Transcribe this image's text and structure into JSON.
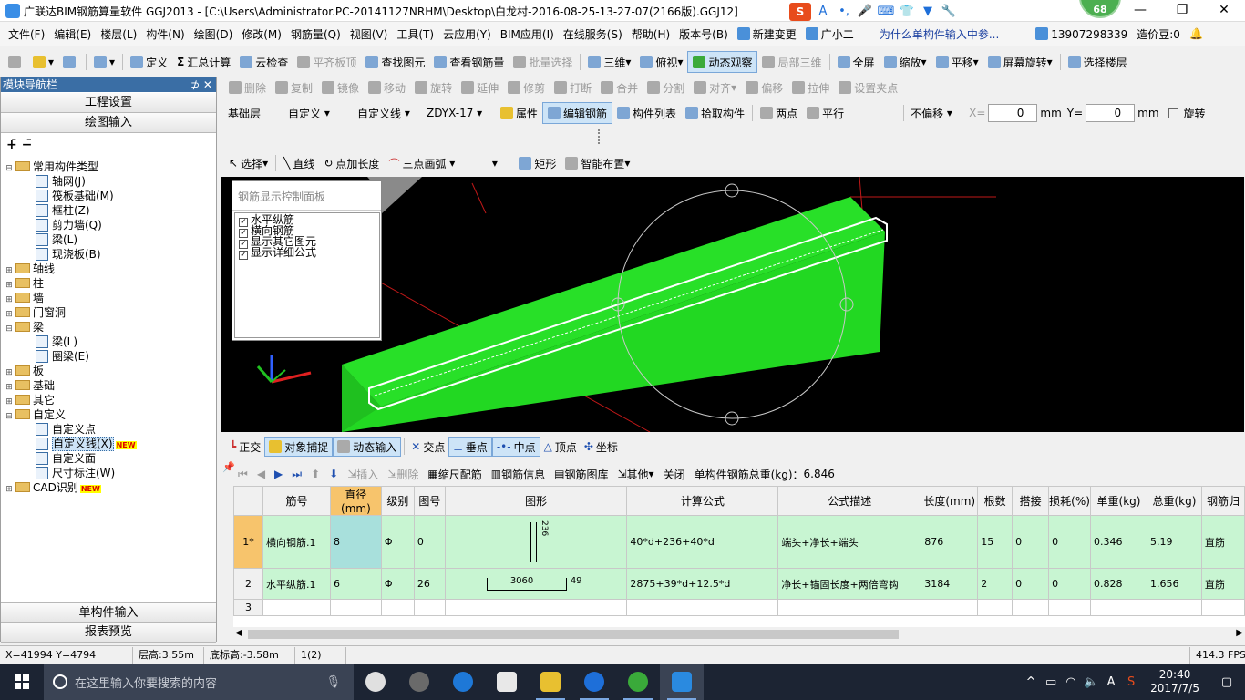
{
  "titlebar": {
    "title": "广联达BIM钢筋算量软件 GGJ2013 - [C:\\Users\\Administrator.PC-20141127NRHM\\Desktop\\白龙村-2016-08-25-13-27-07(2166版).GGJ12]",
    "badge": "68",
    "ime_label": "S",
    "ime_mode": "A",
    "minimize": "—",
    "restore": "❐",
    "close": "✕"
  },
  "menu": {
    "items": [
      "文件(F)",
      "编辑(E)",
      "楼层(L)",
      "构件(N)",
      "绘图(D)",
      "修改(M)",
      "钢筋量(Q)",
      "视图(V)",
      "工具(T)",
      "云应用(Y)",
      "BIM应用(I)",
      "在线服务(S)",
      "帮助(H)",
      "版本号(B)"
    ],
    "new_change": "新建变更",
    "guangxiaoer": "广小二",
    "question": "为什么单构件输入中参...",
    "phone": "13907298339",
    "zaojiadou": "造价豆:0"
  },
  "toolbar1": {
    "items": [
      "定义",
      "汇总计算",
      "云检查",
      "平齐板顶",
      "查找图元",
      "查看钢筋量",
      "批量选择",
      "三维",
      "俯视",
      "动态观察",
      "局部三维",
      "全屏",
      "缩放",
      "平移",
      "屏幕旋转",
      "选择楼层"
    ]
  },
  "toolbar2": {
    "items": [
      "删除",
      "复制",
      "镜像",
      "移动",
      "旋转",
      "延伸",
      "修剪",
      "打断",
      "合并",
      "分割",
      "对齐",
      "偏移",
      "拉伸",
      "设置夹点"
    ]
  },
  "toolbar3": {
    "floor": "基础层",
    "custom": "自定义",
    "custom_line": "自定义线",
    "code": "ZDYX-17",
    "attr": "属性",
    "edit_rebar": "编辑钢筋",
    "component_list": "构件列表",
    "pick": "拾取构件",
    "two_points": "两点",
    "parallel": "平行",
    "offset": "不偏移",
    "x_label": "X=",
    "x_value": "0",
    "y_label": "Y=",
    "y_value": "0",
    "unit": "mm",
    "rotate": "旋转"
  },
  "toolbar4": {
    "select": "选择",
    "line": "直线",
    "point_length": "点加长度",
    "arc": "三点画弧",
    "rect": "矩形",
    "smart": "智能布置"
  },
  "panel": {
    "title": "模块导航栏",
    "pin": "⊅ ✕",
    "eng_settings": "工程设置",
    "draw_input": "绘图输入",
    "single_input": "单构件输入",
    "report_preview": "报表预览",
    "tree": [
      {
        "level": 0,
        "exp": "⊟",
        "folder": true,
        "label": "常用构件类型"
      },
      {
        "level": 1,
        "leaf": true,
        "label": "轴网(J)"
      },
      {
        "level": 1,
        "leaf": true,
        "label": "筏板基础(M)"
      },
      {
        "level": 1,
        "leaf": true,
        "label": "框柱(Z)"
      },
      {
        "level": 1,
        "leaf": true,
        "label": "剪力墙(Q)"
      },
      {
        "level": 1,
        "leaf": true,
        "label": "梁(L)"
      },
      {
        "level": 1,
        "leaf": true,
        "label": "现浇板(B)"
      },
      {
        "level": 0,
        "exp": "⊞",
        "folder": true,
        "label": "轴线"
      },
      {
        "level": 0,
        "exp": "⊞",
        "folder": true,
        "label": "柱"
      },
      {
        "level": 0,
        "exp": "⊞",
        "folder": true,
        "label": "墙"
      },
      {
        "level": 0,
        "exp": "⊞",
        "folder": true,
        "label": "门窗洞"
      },
      {
        "level": 0,
        "exp": "⊟",
        "folder": true,
        "label": "梁"
      },
      {
        "level": 1,
        "leaf": true,
        "label": "梁(L)"
      },
      {
        "level": 1,
        "leaf": true,
        "label": "圈梁(E)"
      },
      {
        "level": 0,
        "exp": "⊞",
        "folder": true,
        "label": "板"
      },
      {
        "level": 0,
        "exp": "⊞",
        "folder": true,
        "label": "基础"
      },
      {
        "level": 0,
        "exp": "⊞",
        "folder": true,
        "label": "其它"
      },
      {
        "level": 0,
        "exp": "⊟",
        "folder": true,
        "label": "自定义"
      },
      {
        "level": 1,
        "leaf": true,
        "label": "自定义点"
      },
      {
        "level": 1,
        "leaf": true,
        "label": "自定义线(X)",
        "selected": true,
        "new": "NEW"
      },
      {
        "level": 1,
        "leaf": true,
        "label": "自定义面"
      },
      {
        "level": 1,
        "leaf": true,
        "label": "尺寸标注(W)"
      },
      {
        "level": 0,
        "exp": "⊞",
        "folder": true,
        "label": "CAD识别",
        "new": "NEW"
      }
    ]
  },
  "rebar_panel": {
    "title": "钢筋显示控制面板",
    "items": [
      "水平纵筋",
      "横向钢筋",
      "显示其它图元",
      "显示详细公式"
    ]
  },
  "snapbar": {
    "items": [
      "正交",
      "对象捕捉",
      "动态输入",
      "交点",
      "垂点",
      "中点",
      "顶点",
      "坐标"
    ]
  },
  "gridtb": {
    "insert": "插入",
    "delete": "删除",
    "scale": "缩尺配筋",
    "info": "钢筋信息",
    "library": "钢筋图库",
    "other": "其他",
    "close": "关闭",
    "total_label": "单构件钢筋总重(kg)：",
    "total_value": "6.846"
  },
  "table": {
    "headers": [
      "",
      "筋号",
      "直径(mm)",
      "级别",
      "图号",
      "图形",
      "计算公式",
      "公式描述",
      "长度(mm)",
      "根数",
      "搭接",
      "损耗(%)",
      "单重(kg)",
      "总重(kg)",
      "钢筋归"
    ],
    "rows": [
      {
        "idx": "1*",
        "name": "横向钢筋.1",
        "dia": "8",
        "grade": "Φ",
        "fig": "0",
        "shape": "236",
        "formula": "40*d+236+40*d",
        "desc": "端头+净长+端头",
        "len": "876",
        "count": "15",
        "lap": "0",
        "loss": "0",
        "unit": "0.346",
        "total": "5.19",
        "type": "直筋"
      },
      {
        "idx": "2",
        "name": "水平纵筋.1",
        "dia": "6",
        "grade": "Φ",
        "fig": "26",
        "shape": "3060",
        "shape2": "49",
        "formula": "2875+39*d+12.5*d",
        "desc": "净长+锚固长度+两倍弯钩",
        "len": "3184",
        "count": "2",
        "lap": "0",
        "loss": "0",
        "unit": "0.828",
        "total": "1.656",
        "type": "直筋"
      },
      {
        "idx": "3",
        "name": "",
        "dia": "",
        "grade": "",
        "fig": "",
        "shape": "",
        "formula": "",
        "desc": "",
        "len": "",
        "count": "",
        "lap": "",
        "loss": "",
        "unit": "",
        "total": "",
        "type": ""
      }
    ]
  },
  "status": {
    "coords": "X=41994 Y=4794",
    "floor_height": "层高:3.55m",
    "base_elev": "底标高:-3.58m",
    "count": "1(2)",
    "fps": "414.3 FPS"
  },
  "taskbar": {
    "search_placeholder": "在这里输入你要搜索的内容",
    "time": "20:40",
    "date": "2017/7/5",
    "lang": "A",
    "notification": "▢"
  },
  "colors": {
    "beam_green": "#22dd22",
    "accent": "#3a6ea5",
    "row_green": "#c8f5d2"
  }
}
